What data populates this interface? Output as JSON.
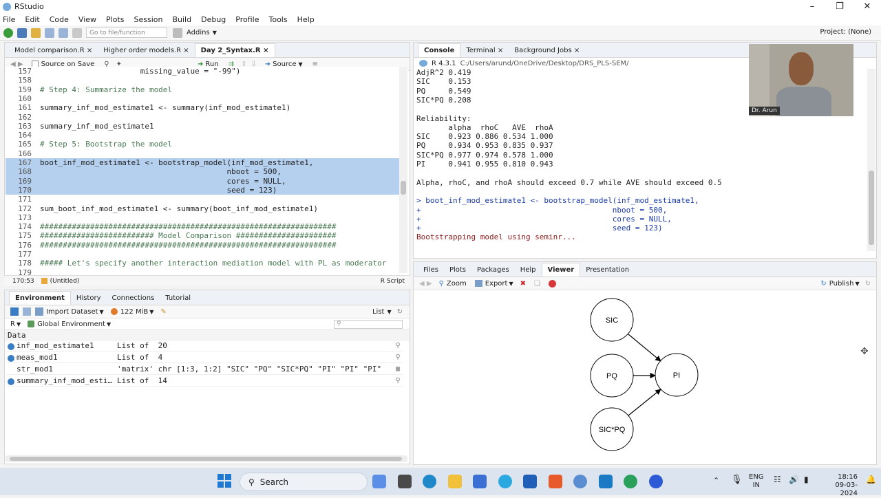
{
  "window": {
    "title": "RStudio"
  },
  "menu": [
    "File",
    "Edit",
    "Code",
    "View",
    "Plots",
    "Session",
    "Build",
    "Debug",
    "Profile",
    "Tools",
    "Help"
  ],
  "toolbar": {
    "goto_placeholder": "Go to file/function",
    "addins": "Addins",
    "project": "Project: (None)"
  },
  "editor": {
    "tabs": [
      "Model comparison.R",
      "Higher order models.R",
      "Day 2_Syntax.R"
    ],
    "active_tab": "Day 2_Syntax.R",
    "source_on_save": "Source on Save",
    "run": "Run",
    "source": "Source",
    "lines": [
      {
        "n": "157",
        "text": "                      missing_value = \"-99\")",
        "type": "code",
        "hl": false
      },
      {
        "n": "158",
        "text": "",
        "type": "code",
        "hl": false
      },
      {
        "n": "159",
        "text": "# Step 4: Summarize the model",
        "type": "comment",
        "hl": false
      },
      {
        "n": "160",
        "text": "",
        "type": "code",
        "hl": false
      },
      {
        "n": "161",
        "text": "summary_inf_mod_estimate1 <- summary(inf_mod_estimate1)",
        "type": "code",
        "hl": false
      },
      {
        "n": "162",
        "text": "",
        "type": "code",
        "hl": false
      },
      {
        "n": "163",
        "text": "summary_inf_mod_estimate1",
        "type": "code",
        "hl": false
      },
      {
        "n": "164",
        "text": "",
        "type": "code",
        "hl": false
      },
      {
        "n": "165",
        "text": "# Step 5: Bootstrap the model",
        "type": "comment",
        "hl": false
      },
      {
        "n": "166",
        "text": "",
        "type": "code",
        "hl": false
      },
      {
        "n": "167",
        "text": "boot_inf_mod_estimate1 <- bootstrap_model(inf_mod_estimate1,",
        "type": "code",
        "hl": true
      },
      {
        "n": "168",
        "text": "                                         nboot = 500,",
        "type": "code",
        "hl": true
      },
      {
        "n": "169",
        "text": "                                         cores = NULL,",
        "type": "code",
        "hl": true
      },
      {
        "n": "170",
        "text": "                                         seed = 123)",
        "type": "code",
        "hl": true
      },
      {
        "n": "171",
        "text": "",
        "type": "code",
        "hl": false
      },
      {
        "n": "172",
        "text": "sum_boot_inf_mod_estimate1 <- summary(boot_inf_mod_estimate1)",
        "type": "code",
        "hl": false
      },
      {
        "n": "173",
        "text": "",
        "type": "code",
        "hl": false
      },
      {
        "n": "174",
        "text": "#################################################################",
        "type": "comment",
        "hl": false
      },
      {
        "n": "175",
        "text": "######################### Model Comparison ######################",
        "type": "comment",
        "hl": false
      },
      {
        "n": "176",
        "text": "#################################################################",
        "type": "comment",
        "hl": false
      },
      {
        "n": "177",
        "text": "",
        "type": "code",
        "hl": false
      },
      {
        "n": "178",
        "text": "##### Let's specify another interaction mediation model with PL as moderator",
        "type": "comment",
        "hl": false
      },
      {
        "n": "179",
        "text": "",
        "type": "code",
        "hl": false
      }
    ],
    "status_pos": "170:53",
    "status_scope": "(Untitled)",
    "status_lang": "R Script"
  },
  "console": {
    "tabs": [
      "Console",
      "Terminal",
      "Background Jobs"
    ],
    "r_version": "R 4.3.1",
    "path": "C:/Users/arund/OneDrive/Desktop/DRS_PLS-SEM/",
    "lines": [
      {
        "text": "AdjR^2 0.419",
        "cls": ""
      },
      {
        "text": "SIC    0.153",
        "cls": ""
      },
      {
        "text": "PQ     0.549",
        "cls": ""
      },
      {
        "text": "SIC*PQ 0.208",
        "cls": ""
      },
      {
        "text": "",
        "cls": ""
      },
      {
        "text": "Reliability:",
        "cls": ""
      },
      {
        "text": "       alpha  rhoC   AVE  rhoA",
        "cls": ""
      },
      {
        "text": "SIC    0.923 0.886 0.534 1.000",
        "cls": ""
      },
      {
        "text": "PQ     0.934 0.953 0.835 0.937",
        "cls": ""
      },
      {
        "text": "SIC*PQ 0.977 0.974 0.578 1.000",
        "cls": ""
      },
      {
        "text": "PI     0.941 0.955 0.810 0.943",
        "cls": ""
      },
      {
        "text": "",
        "cls": ""
      },
      {
        "text": "Alpha, rhoC, and rhoA should exceed 0.7 while AVE should exceed 0.5",
        "cls": ""
      },
      {
        "text": "",
        "cls": ""
      },
      {
        "text": "> boot_inf_mod_estimate1 <- bootstrap_model(inf_mod_estimate1,",
        "cls": "blue"
      },
      {
        "text": "+                                          nboot = 500,",
        "cls": "blue"
      },
      {
        "text": "+                                          cores = NULL,",
        "cls": "blue"
      },
      {
        "text": "+                                          seed = 123)",
        "cls": "blue"
      },
      {
        "text": "Bootstrapping model using seminr...",
        "cls": "red"
      }
    ]
  },
  "environment": {
    "tabs": [
      "Environment",
      "History",
      "Connections",
      "Tutorial"
    ],
    "import_dataset": "Import Dataset",
    "memory": "122 MiB",
    "list_label": "List",
    "lang": "R",
    "scope": "Global Environment",
    "section": "Data",
    "rows": [
      {
        "name": "inf_mod_estimate1",
        "value": "List of  20",
        "dot": true
      },
      {
        "name": "meas_mod1",
        "value": "List of  4",
        "dot": true
      },
      {
        "name": "str_mod1",
        "value": "'matrix' chr [1:3, 1:2] \"SIC\" \"PQ\" \"SIC*PQ\" \"PI\" \"PI\" \"PI\"",
        "dot": false
      },
      {
        "name": "summary_inf_mod_esti…",
        "value": "List of  14",
        "dot": true
      }
    ]
  },
  "viewer": {
    "tabs": [
      "Files",
      "Plots",
      "Packages",
      "Help",
      "Viewer",
      "Presentation"
    ],
    "active_tab": "Viewer",
    "zoom": "Zoom",
    "export": "Export",
    "publish": "Publish",
    "nodes": {
      "sic": "SIC",
      "pq": "PQ",
      "sicpq": "SIC*PQ",
      "pi": "PI"
    }
  },
  "webcam": {
    "label": "Dr. Arun"
  },
  "taskbar": {
    "search": "Search",
    "lang_top": "ENG",
    "lang_bottom": "IN",
    "time": "18:16",
    "date": "09-03-2024"
  }
}
